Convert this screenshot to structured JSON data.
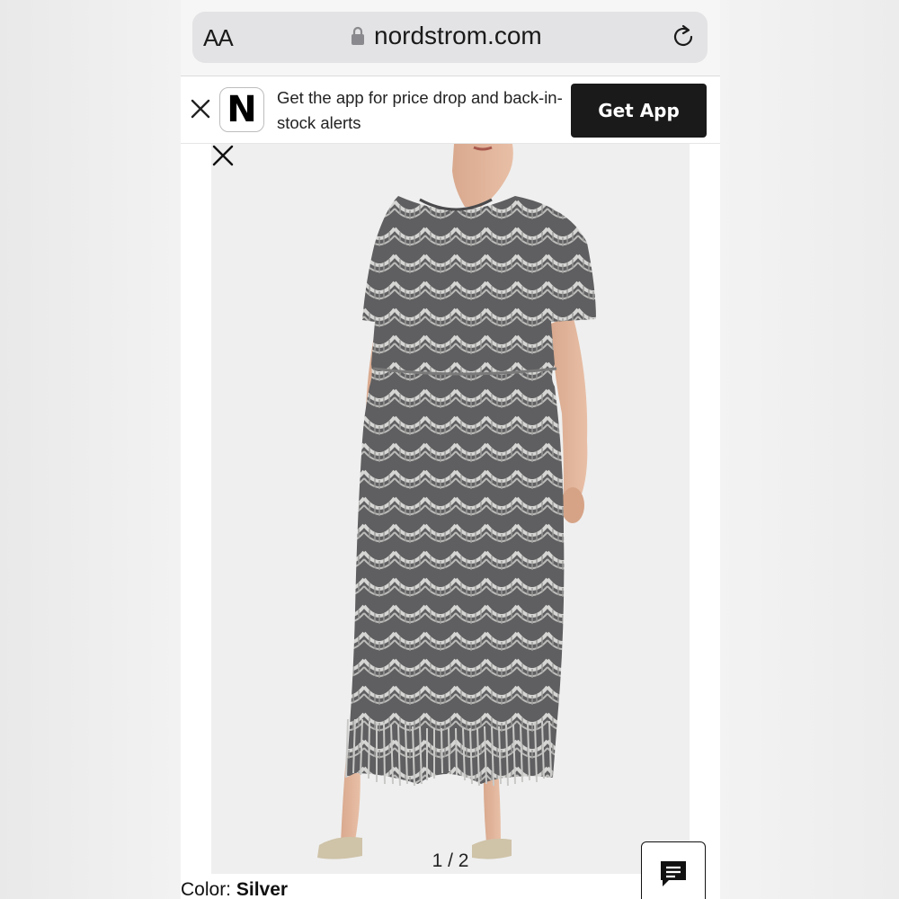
{
  "browser": {
    "text_size_label": "AA",
    "domain": "nordstrom.com"
  },
  "banner": {
    "logo_letter": "N",
    "message": "Get the app for price drop and back-in-stock alerts",
    "cta_label": "Get App"
  },
  "gallery": {
    "pager": "1 / 2"
  },
  "product": {
    "color_label": "Color:",
    "color_value": "Silver"
  },
  "icons": {
    "lock": "lock-icon",
    "reload": "reload-icon",
    "banner_close": "close-icon",
    "gallery_close": "close-icon",
    "chat": "chat-icon"
  }
}
